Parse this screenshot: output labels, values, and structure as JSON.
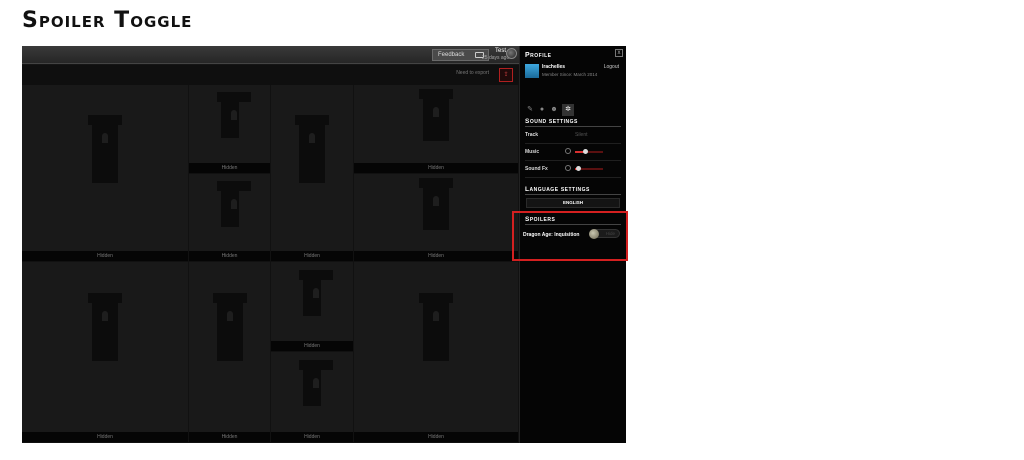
{
  "heading": "Spoiler Toggle",
  "topbar": {
    "feedback_label": "Feedback",
    "user_name": "Test",
    "user_time": "25 days ago"
  },
  "subbar": {
    "export_label": "Need to export"
  },
  "tiles": {
    "hidden_label": "Hidden"
  },
  "profile": {
    "title": "Profile",
    "close_glyph": "x",
    "name": "Irachelles",
    "member_since": "Member Since: March 2014",
    "logout": "Logout"
  },
  "sound": {
    "title": "Sound settings",
    "track_label": "Track",
    "track_value": "Silent",
    "music_label": "Music",
    "music_level": 0.35,
    "sfx_label": "Sound Fx",
    "sfx_level": 0.1
  },
  "language": {
    "title": "Language settings",
    "value": "ENGLISH"
  },
  "spoilers": {
    "title": "Spoilers",
    "item_label": "Dragon Age: Inquisition",
    "state": "Hide"
  },
  "colors": {
    "highlight": "#d42020",
    "accent_red": "#d83030"
  }
}
